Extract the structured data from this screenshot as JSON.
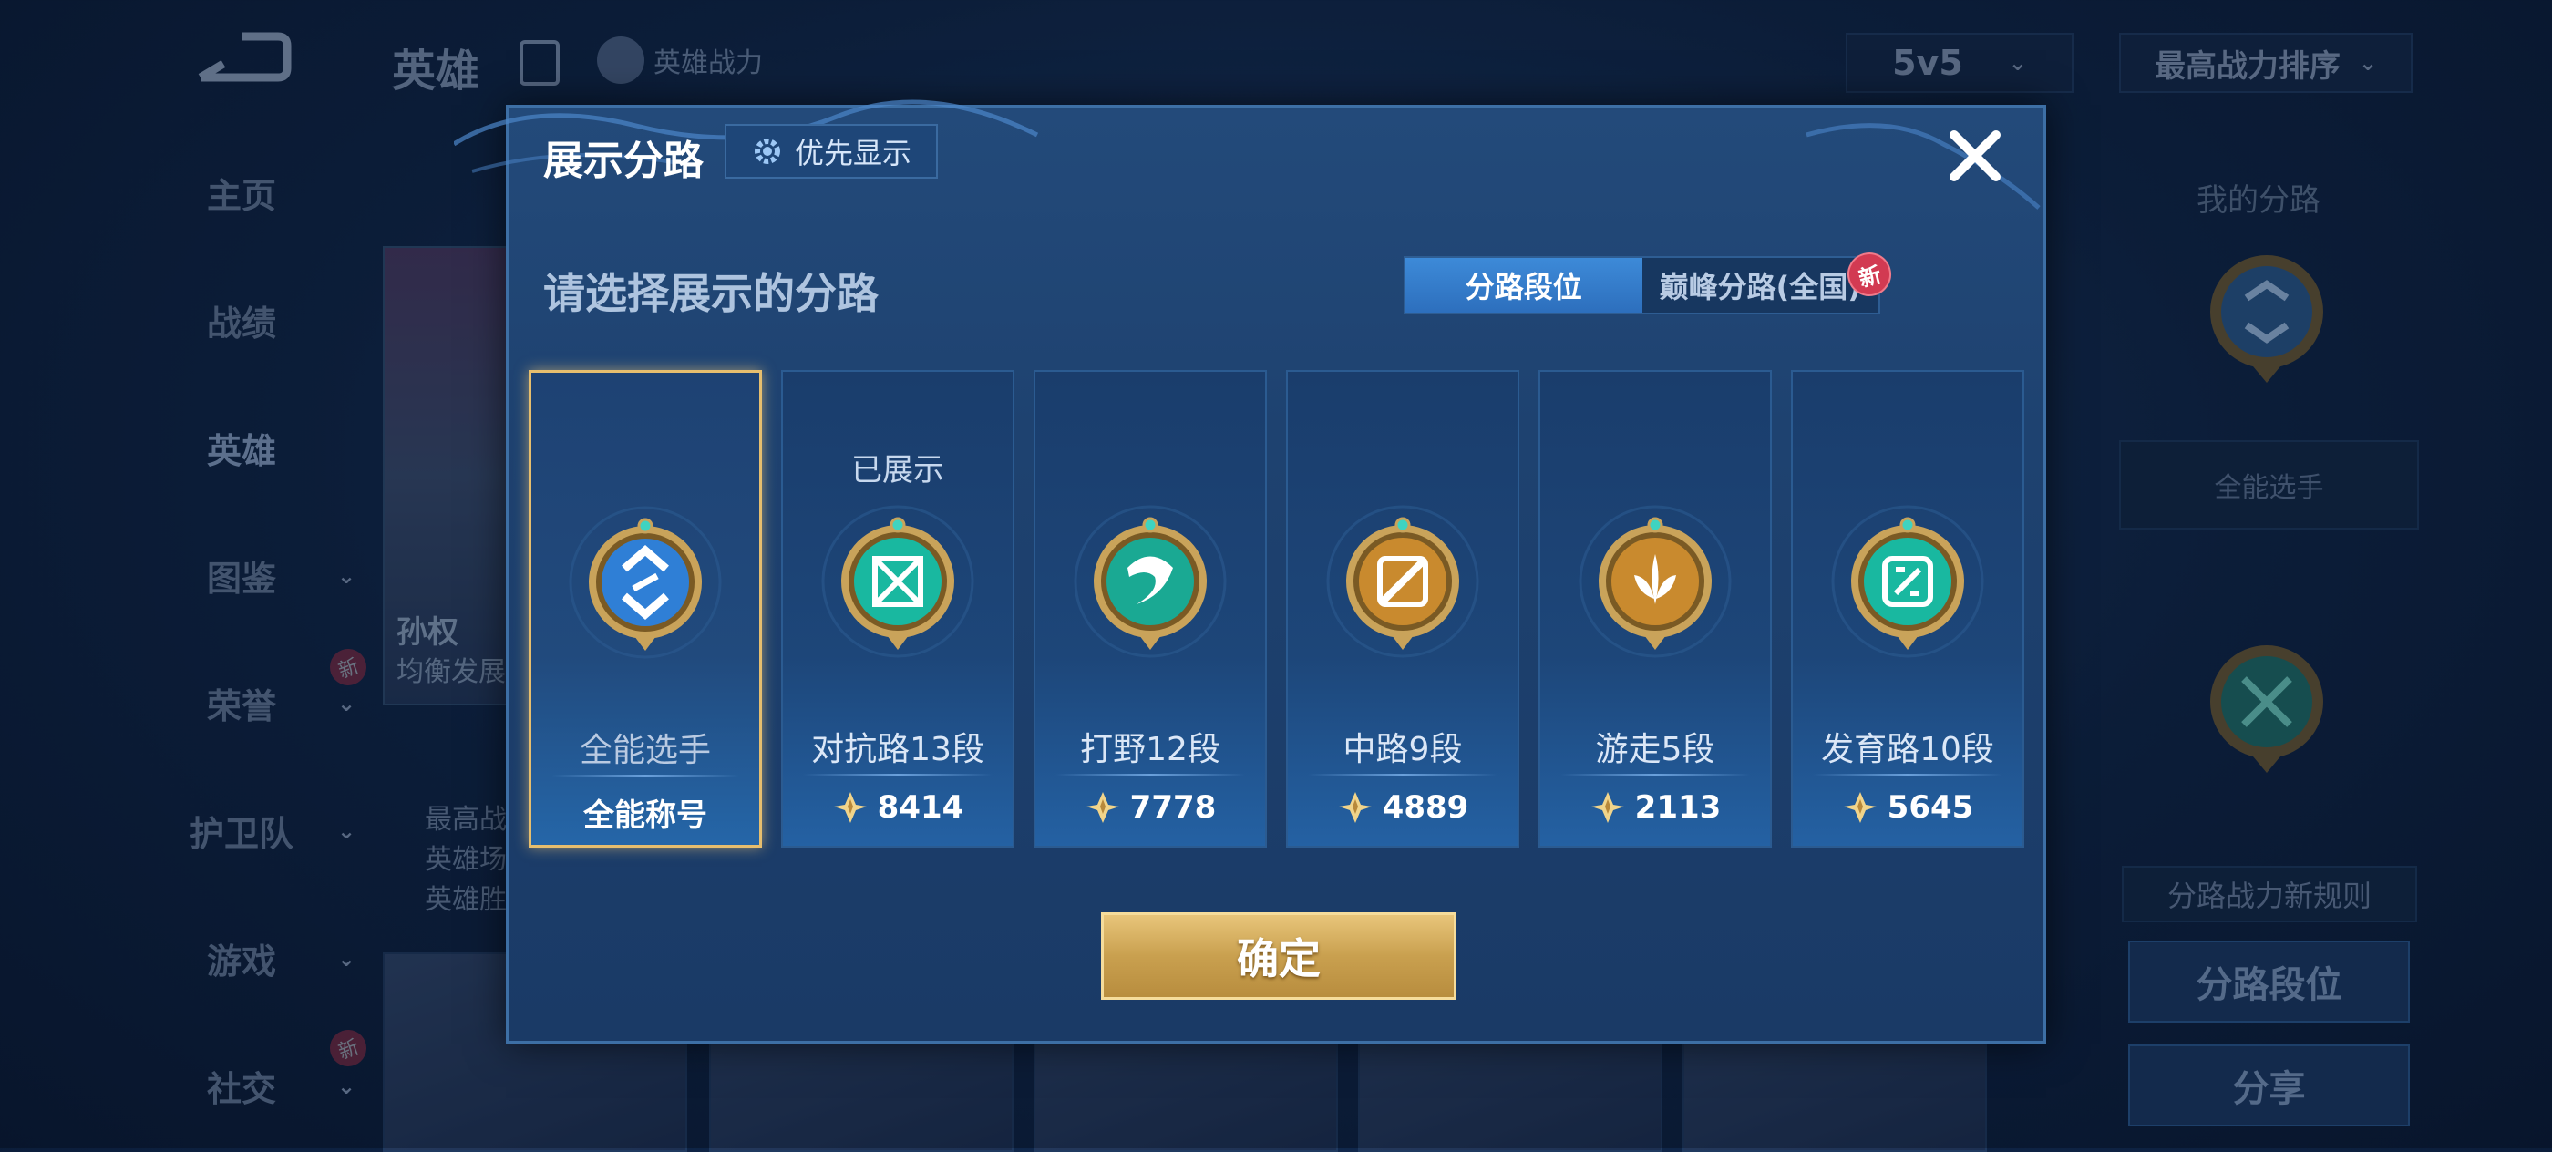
{
  "background": {
    "title": "英雄",
    "power_link": "英雄战力",
    "mode": "5v5",
    "sort": "最高战力排序",
    "nav": [
      {
        "label": "主页"
      },
      {
        "label": "战绩"
      },
      {
        "label": "英雄"
      },
      {
        "label": "图鉴"
      },
      {
        "label": "荣誉",
        "badge": "新"
      },
      {
        "label": "护卫队"
      },
      {
        "label": "游戏"
      },
      {
        "label": "社交",
        "badge": "新"
      }
    ],
    "hero_card": {
      "name": "孙权",
      "subtitle": "均衡发展",
      "stats": [
        "最高战",
        "英雄场",
        "英雄胜"
      ]
    },
    "side": {
      "my_lane": "我的分路",
      "lane_box": "全能选手",
      "rule": "分路战力新规则",
      "lane_rank_button": "分路段位",
      "share_button": "分享"
    }
  },
  "modal": {
    "title": "展示分路",
    "priority_button": "优先显示",
    "prompt": "请选择展示的分路",
    "tabs": [
      {
        "label": "分路段位",
        "active": true
      },
      {
        "label": "巅峰分路(全国)",
        "active": false,
        "badge": "新"
      }
    ],
    "cards": [
      {
        "lane": "全能选手",
        "value": "全能称号",
        "selected": true,
        "shown_label": "",
        "medal": "all-round-medal",
        "color": "#2f7fd6"
      },
      {
        "lane": "对抗路13段",
        "value": "8414",
        "selected": false,
        "shown_label": "已展示",
        "medal": "clash-lane-medal",
        "color": "#19b8a0"
      },
      {
        "lane": "打野12段",
        "value": "7778",
        "selected": false,
        "shown_label": "",
        "medal": "jungle-medal",
        "color": "#1aa993"
      },
      {
        "lane": "中路9段",
        "value": "4889",
        "selected": false,
        "shown_label": "",
        "medal": "mid-lane-medal",
        "color": "#c98a2e"
      },
      {
        "lane": "游走5段",
        "value": "2113",
        "selected": false,
        "shown_label": "",
        "medal": "roam-medal",
        "color": "#c98a2e"
      },
      {
        "lane": "发育路10段",
        "value": "5645",
        "selected": false,
        "shown_label": "",
        "medal": "farm-lane-medal",
        "color": "#19b8a0"
      }
    ],
    "confirm_button": "确定"
  }
}
